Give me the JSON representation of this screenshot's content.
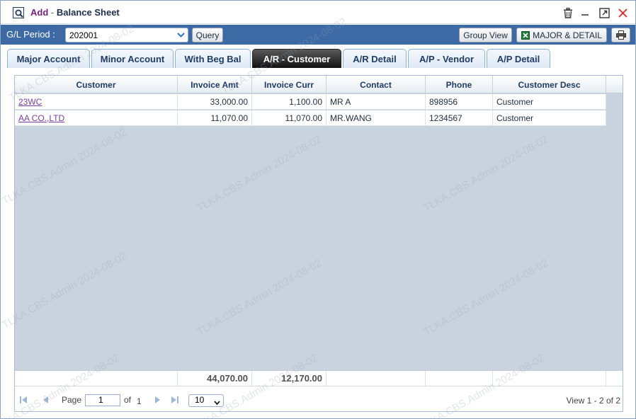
{
  "window": {
    "title_action": "Add",
    "title_separator": "-",
    "title": "Balance Sheet"
  },
  "toolbar": {
    "gl_period_label": "G/L Period :",
    "gl_period_value": "202001",
    "query_label": "Query",
    "group_view_label": "Group View",
    "major_detail_label": "MAJOR & DETAIL"
  },
  "tabs": [
    {
      "label": "Major Account"
    },
    {
      "label": "Minor Account"
    },
    {
      "label": "With Beg Bal"
    },
    {
      "label": "A/R - Customer"
    },
    {
      "label": "A/R Detail"
    },
    {
      "label": "A/P - Vendor"
    },
    {
      "label": "A/P Detail"
    }
  ],
  "active_tab": "A/R - Customer",
  "grid": {
    "columns": [
      "Customer",
      "Invoice Amt",
      "Invoice Curr",
      "Contact",
      "Phone",
      "Customer Desc"
    ],
    "rows": [
      {
        "customer": "23WC",
        "invoice_amt": "33,000.00",
        "invoice_curr": "1,100.00",
        "contact": "MR A",
        "phone": "898956",
        "desc": "Customer"
      },
      {
        "customer": "AA CO.,LTD",
        "invoice_amt": "11,070.00",
        "invoice_curr": "11,070.00",
        "contact": "MR.WANG",
        "phone": "1234567",
        "desc": "Customer"
      }
    ],
    "totals": {
      "invoice_amt": "44,070.00",
      "invoice_curr": "12,170.00"
    }
  },
  "pager": {
    "page_label": "Page",
    "page_value": "1",
    "of_label": "of",
    "total_pages": "1",
    "rows_per_page": "10",
    "view_text": "View 1 - 2 of 2"
  },
  "watermark_text": "TLKA.CBS.Admin 2024-08-02",
  "colors": {
    "toolbar_bg": "#3d6aa5",
    "active_tab_bg": "#111111",
    "link": "#7a3c9c",
    "close_x": "#e0262b"
  }
}
